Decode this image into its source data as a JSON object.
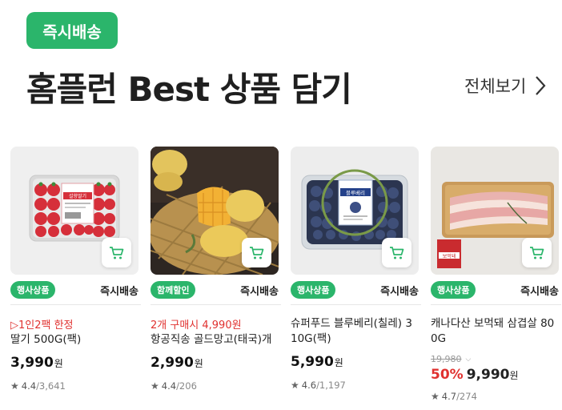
{
  "header": {
    "badge": "즉시배송",
    "title": "홈플런 Best 상품 담기",
    "view_all": "전체보기"
  },
  "products": [
    {
      "tag": "행사상품",
      "delivery": "즉시배송",
      "promo": "▷1인2팩 한정",
      "name": "딸기 500G(팩)",
      "price": "3,990",
      "currency": "원",
      "rating": "4.4",
      "reviews": "/3,641",
      "package_label": "설향딸기",
      "image": "strawberry-pack"
    },
    {
      "tag": "함께할인",
      "delivery": "즉시배송",
      "promo": "2개 구매시 4,990원",
      "name": "항공직송 골드망고(태국)개",
      "price": "2,990",
      "currency": "원",
      "rating": "4.4",
      "reviews": "/206",
      "image": "gold-mango"
    },
    {
      "tag": "행사상품",
      "delivery": "즉시배송",
      "promo": "",
      "name": "슈퍼푸드 블루베리(칠레) 310G(팩)",
      "price": "5,990",
      "currency": "원",
      "rating": "4.6",
      "reviews": "/1,197",
      "package_label": "블루베리",
      "image": "blueberry-pack"
    },
    {
      "tag": "행사상품",
      "delivery": "즉시배송",
      "name": "캐나다산 보먹돼 삼겹살 800G",
      "original_price": "19,980",
      "discount": "50%",
      "price": "9,990",
      "currency": "원",
      "rating": "4.7",
      "reviews": "/274",
      "brand_sticker": "보먹돼",
      "image": "pork-belly"
    }
  ],
  "colors": {
    "accent_green": "#2bb56b",
    "promo_red": "#e0312f"
  }
}
